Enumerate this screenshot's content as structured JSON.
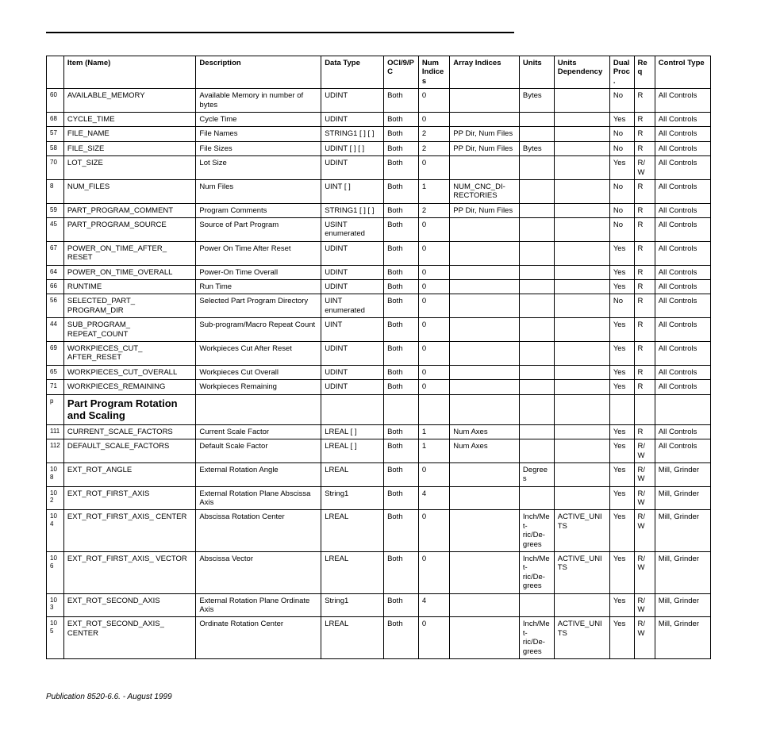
{
  "headers": {
    "num": "",
    "item": "Item (Name)",
    "desc": "Description",
    "dtype": "Data Type",
    "oci": "OCI/9/PC",
    "nidx": "Num Indices",
    "arr": "Array Indices",
    "units": "Units",
    "udep": "Units Dependency",
    "dual": "Dual Proc.",
    "req": "Req",
    "ctl": "Control Type"
  },
  "section_heading": "Part Program Rotation and Scaling",
  "rows_a": [
    {
      "num": "60",
      "item": "AVAILABLE_MEMORY",
      "desc": "Available Memory in number of bytes",
      "dtype": "UDINT",
      "oci": "Both",
      "nidx": "0",
      "arr": "",
      "units": "Bytes",
      "udep": "",
      "dual": "No",
      "req": "R",
      "ctl": "All Controls"
    },
    {
      "num": "68",
      "item": "CYCLE_TIME",
      "desc": "Cycle Time",
      "dtype": "UDINT",
      "oci": "Both",
      "nidx": "0",
      "arr": "",
      "units": "",
      "udep": "",
      "dual": "Yes",
      "req": "R",
      "ctl": "All Controls"
    },
    {
      "num": "57",
      "item": "FILE_NAME",
      "desc": "File Names",
      "dtype": "STRING1 [ ] [ ]",
      "oci": "Both",
      "nidx": "2",
      "arr": "PP Dir, Num Files",
      "units": "",
      "udep": "",
      "dual": "No",
      "req": "R",
      "ctl": "All Controls"
    },
    {
      "num": "58",
      "item": "FILE_SIZE",
      "desc": "File Sizes",
      "dtype": "UDINT [ ] [ ]",
      "oci": "Both",
      "nidx": "2",
      "arr": "PP Dir, Num Files",
      "units": "Bytes",
      "udep": "",
      "dual": "No",
      "req": "R",
      "ctl": "All Controls"
    },
    {
      "num": "70",
      "item": "LOT_SIZE",
      "desc": "Lot Size",
      "dtype": "UDINT",
      "oci": "Both",
      "nidx": "0",
      "arr": "",
      "units": "",
      "udep": "",
      "dual": "Yes",
      "req": "R/W",
      "ctl": "All Controls"
    },
    {
      "num": "8",
      "item": "NUM_FILES",
      "desc": "Num Files",
      "dtype": "UINT [ ]",
      "oci": "Both",
      "nidx": "1",
      "arr": "NUM_CNC_DI- RECTORIES",
      "units": "",
      "udep": "",
      "dual": "No",
      "req": "R",
      "ctl": "All Controls"
    },
    {
      "num": "59",
      "item": "PART_PROGRAM_COMMENT",
      "desc": "Program Comments",
      "dtype": "STRING1 [ ] [ ]",
      "oci": "Both",
      "nidx": "2",
      "arr": "PP Dir, Num Files",
      "units": "",
      "udep": "",
      "dual": "No",
      "req": "R",
      "ctl": "All Controls"
    },
    {
      "num": "45",
      "item": "PART_PROGRAM_SOURCE",
      "desc": "Source of Part Program",
      "dtype": "USINT   enumerated",
      "oci": "Both",
      "nidx": "0",
      "arr": "",
      "units": "",
      "udep": "",
      "dual": "No",
      "req": "R",
      "ctl": "All Controls"
    },
    {
      "num": "67",
      "item": "POWER_ON_TIME_AFTER_ RESET",
      "desc": "Power On Time After Reset",
      "dtype": "UDINT",
      "oci": "Both",
      "nidx": "0",
      "arr": "",
      "units": "",
      "udep": "",
      "dual": "Yes",
      "req": "R",
      "ctl": "All Controls"
    },
    {
      "num": "64",
      "item": "POWER_ON_TIME_OVERALL",
      "desc": "Power-On Time Overall",
      "dtype": "UDINT",
      "oci": "Both",
      "nidx": "0",
      "arr": "",
      "units": "",
      "udep": "",
      "dual": "Yes",
      "req": "R",
      "ctl": "All Controls"
    },
    {
      "num": "66",
      "item": "RUNTIME",
      "desc": "Run Time",
      "dtype": "UDINT",
      "oci": "Both",
      "nidx": "0",
      "arr": "",
      "units": "",
      "udep": "",
      "dual": "Yes",
      "req": "R",
      "ctl": "All Controls"
    },
    {
      "num": "56",
      "item": "SELECTED_PART_ PROGRAM_DIR",
      "desc": "Selected Part Program Directory",
      "dtype": "UINT  enumerated",
      "oci": "Both",
      "nidx": "0",
      "arr": "",
      "units": "",
      "udep": "",
      "dual": "No",
      "req": "R",
      "ctl": "All Controls"
    },
    {
      "num": "44",
      "item": "SUB_PROGRAM_ REPEAT_COUNT",
      "desc": "Sub-program/Macro Repeat Count",
      "dtype": "UINT",
      "oci": "Both",
      "nidx": "0",
      "arr": "",
      "units": "",
      "udep": "",
      "dual": "Yes",
      "req": "R",
      "ctl": "All Controls"
    },
    {
      "num": "69",
      "item": "WORKPIECES_CUT_ AFTER_RESET",
      "desc": "Workpieces Cut After Reset",
      "dtype": "UDINT",
      "oci": "Both",
      "nidx": "0",
      "arr": "",
      "units": "",
      "udep": "",
      "dual": "Yes",
      "req": "R",
      "ctl": "All Controls"
    },
    {
      "num": "65",
      "item": "WORKPIECES_CUT_OVERALL",
      "desc": "Workpieces Cut Overall",
      "dtype": "UDINT",
      "oci": "Both",
      "nidx": "0",
      "arr": "",
      "units": "",
      "udep": "",
      "dual": "Yes",
      "req": "R",
      "ctl": "All Controls"
    },
    {
      "num": "71",
      "item": "WORKPIECES_REMAINING",
      "desc": "Workpieces Remaining",
      "dtype": "UDINT",
      "oci": "Both",
      "nidx": "0",
      "arr": "",
      "units": "",
      "udep": "",
      "dual": "Yes",
      "req": "R",
      "ctl": "All Controls"
    }
  ],
  "section_num": "p",
  "rows_b": [
    {
      "num": "111",
      "item": "CURRENT_SCALE_FACTORS",
      "desc": "Current Scale Factor",
      "dtype": "LREAL [ ]",
      "oci": "Both",
      "nidx": "1",
      "arr": "Num Axes",
      "units": "",
      "udep": "",
      "dual": "Yes",
      "req": "R",
      "ctl": "All Controls"
    },
    {
      "num": "112",
      "item": "DEFAULT_SCALE_FACTORS",
      "desc": "Default Scale Factor",
      "dtype": "LREAL [ ]",
      "oci": "Both",
      "nidx": "1",
      "arr": "Num Axes",
      "units": "",
      "udep": "",
      "dual": "Yes",
      "req": "R/W",
      "ctl": "All Controls"
    },
    {
      "num": "108",
      "item": "EXT_ROT_ANGLE",
      "desc": "External Rotation Angle",
      "dtype": "LREAL",
      "oci": "Both",
      "nidx": "0",
      "arr": "",
      "units": "Degrees",
      "udep": "",
      "dual": "Yes",
      "req": "R/W",
      "ctl": "Mill, Grinder"
    },
    {
      "num": "102",
      "item": "EXT_ROT_FIRST_AXIS",
      "desc": "External Rotation Plane Abscissa Axis",
      "dtype": "String1",
      "oci": "Both",
      "nidx": "4",
      "arr": "",
      "units": "",
      "udep": "",
      "dual": "Yes",
      "req": "R/W",
      "ctl": "Mill, Grinder"
    },
    {
      "num": "104",
      "item": "EXT_ROT_FIRST_AXIS_ CENTER",
      "desc": "Abscissa Rotation Center",
      "dtype": "LREAL",
      "oci": "Both",
      "nidx": "0",
      "arr": "",
      "units": "Inch/Met- ric/De- grees",
      "udep": "ACTIVE_UNITS",
      "dual": "Yes",
      "req": "R/W",
      "ctl": "Mill, Grinder"
    },
    {
      "num": "106",
      "item": "EXT_ROT_FIRST_AXIS_ VECTOR",
      "desc": "Abscissa Vector",
      "dtype": "LREAL",
      "oci": "Both",
      "nidx": "0",
      "arr": "",
      "units": "Inch/Met- ric/De- grees",
      "udep": "ACTIVE_UNITS",
      "dual": "Yes",
      "req": "R/W",
      "ctl": "Mill, Grinder"
    },
    {
      "num": "103",
      "item": "EXT_ROT_SECOND_AXIS",
      "desc": "External Rotation Plane Ordinate Axis",
      "dtype": "String1",
      "oci": "Both",
      "nidx": "4",
      "arr": "",
      "units": "",
      "udep": "",
      "dual": "Yes",
      "req": "R/W",
      "ctl": "Mill, Grinder"
    },
    {
      "num": "105",
      "item": "EXT_ROT_SECOND_AXIS_ CENTER",
      "desc": "Ordinate Rotation Center",
      "dtype": "LREAL",
      "oci": "Both",
      "nidx": "0",
      "arr": "",
      "units": "Inch/Met- ric/De- grees",
      "udep": "ACTIVE_UNITS",
      "dual": "Yes",
      "req": "R/W",
      "ctl": "Mill, Grinder"
    }
  ],
  "footer": "Publication 8520-6.6. - August 1999"
}
